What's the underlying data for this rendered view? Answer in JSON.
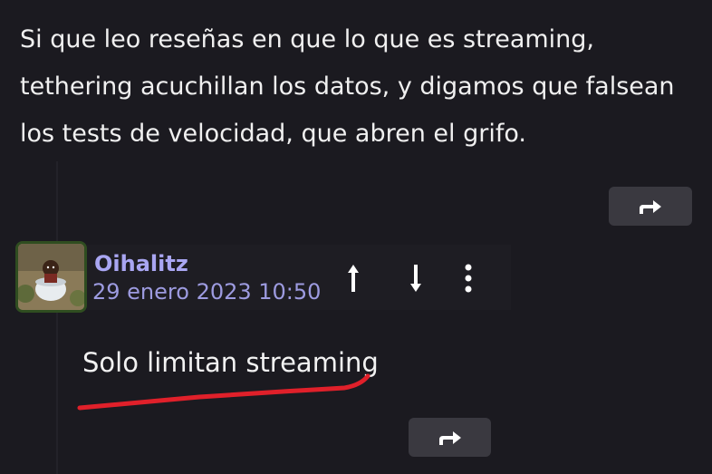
{
  "post": {
    "text": "Si que leo reseñas en que lo que es streaming, tethering acuchillan los datos, y digamos que falsean los tests de velocidad, que abren el grifo."
  },
  "comment": {
    "username": "Oihalitz",
    "timestamp": "29 enero 2023 10:50",
    "text": "Solo limitan streaming"
  },
  "icons": {
    "reply": "reply-arrow-icon",
    "upvote": "arrow-up-icon",
    "downvote": "arrow-down-icon",
    "more": "more-vertical-icon"
  },
  "colors": {
    "background": "#1b1a20",
    "button": "#3a3940",
    "username": "#a9a6f2",
    "timestamp": "#9d9be0",
    "avatar_border": "#2f4d20",
    "annotation": "#e0202a"
  }
}
